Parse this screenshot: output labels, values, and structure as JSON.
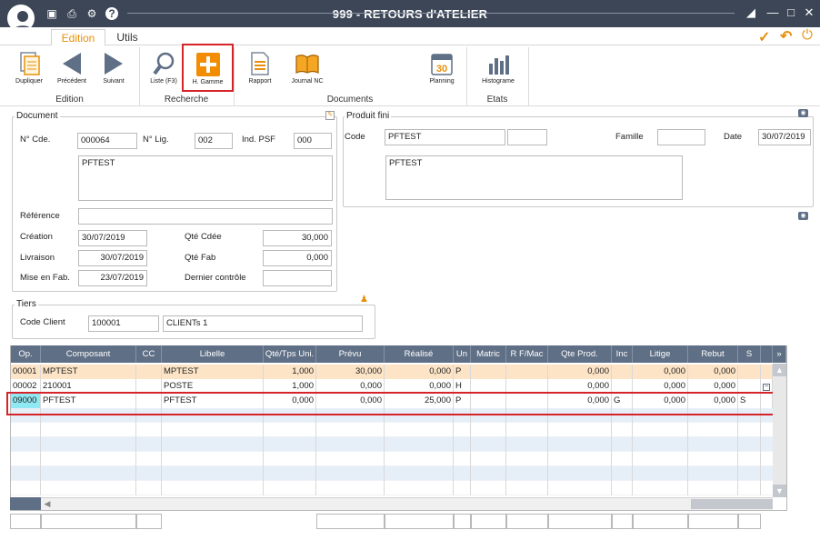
{
  "window": {
    "title": "999 - RETOURS d'ATELIER"
  },
  "tabs": [
    {
      "label": "Edition"
    },
    {
      "label": "Utils"
    }
  ],
  "ribbon": {
    "buttons": [
      {
        "label": "Dupliquer"
      },
      {
        "label": "Précédent"
      },
      {
        "label": "Suivant"
      },
      {
        "label": "Liste (F3)"
      },
      {
        "label": "H. Gamme"
      },
      {
        "label": "Rapport"
      },
      {
        "label": "Journal NC"
      },
      {
        "label": "Planning"
      },
      {
        "label": "Histograme"
      }
    ],
    "groups": [
      "Edition",
      "Recherche",
      "Documents",
      "Etats"
    ],
    "planning_day": "30"
  },
  "document": {
    "legend": "Document",
    "cde_label": "N° Cde.",
    "cde": "000064",
    "lig_label": "N° Lig.",
    "lig": "002",
    "psf_label": "Ind. PSF",
    "psf": "000",
    "designation": "PFTEST",
    "reference_label": "Référence",
    "reference": "",
    "creation_label": "Création",
    "creation": "30/07/2019",
    "livraison_label": "Livraison",
    "livraison": "30/07/2019",
    "mise_label": "Mise en Fab.",
    "mise": "23/07/2019",
    "qte_cdee_label": "Qté Cdée",
    "qte_cdee": "30,000",
    "qte_fab_label": "Qté Fab",
    "qte_fab": "0,000",
    "dernier_label": "Dernier contrôle",
    "dernier": ""
  },
  "produit": {
    "legend": "Produit fini",
    "code_label": "Code",
    "code": "PFTEST",
    "code2": "",
    "famille_label": "Famille",
    "famille": "",
    "date_label": "Date",
    "date": "30/07/2019",
    "designation": "PFTEST"
  },
  "tiers": {
    "legend": "Tiers",
    "client_label": "Code Client",
    "client": "100001",
    "client_name": "CLIENTs   1"
  },
  "grid": {
    "columns": [
      "Op.",
      "Composant",
      "CC",
      "Libelle",
      "Qté/Tps Uni.",
      "Prévu",
      "Réalisé",
      "Un",
      "Matric",
      "R F/Mac",
      "Qte Prod.",
      "Inc",
      "Litige",
      "Rebut",
      "S"
    ],
    "rows": [
      [
        "00001",
        "MPTEST",
        "",
        "MPTEST",
        "1,000",
        "30,000",
        "0,000",
        "P",
        "",
        "",
        "0,000",
        "",
        "0,000",
        "0,000",
        ""
      ],
      [
        "00002",
        "210001",
        "",
        "POSTE",
        "1,000",
        "0,000",
        "0,000",
        "H",
        "",
        "",
        "0,000",
        "",
        "0,000",
        "0,000",
        ""
      ],
      [
        "09000",
        "PFTEST",
        "",
        "PFTEST",
        "0,000",
        "0,000",
        "25,000",
        "P",
        "",
        "",
        "0,000",
        "G",
        "0,000",
        "0,000",
        "S"
      ]
    ]
  }
}
